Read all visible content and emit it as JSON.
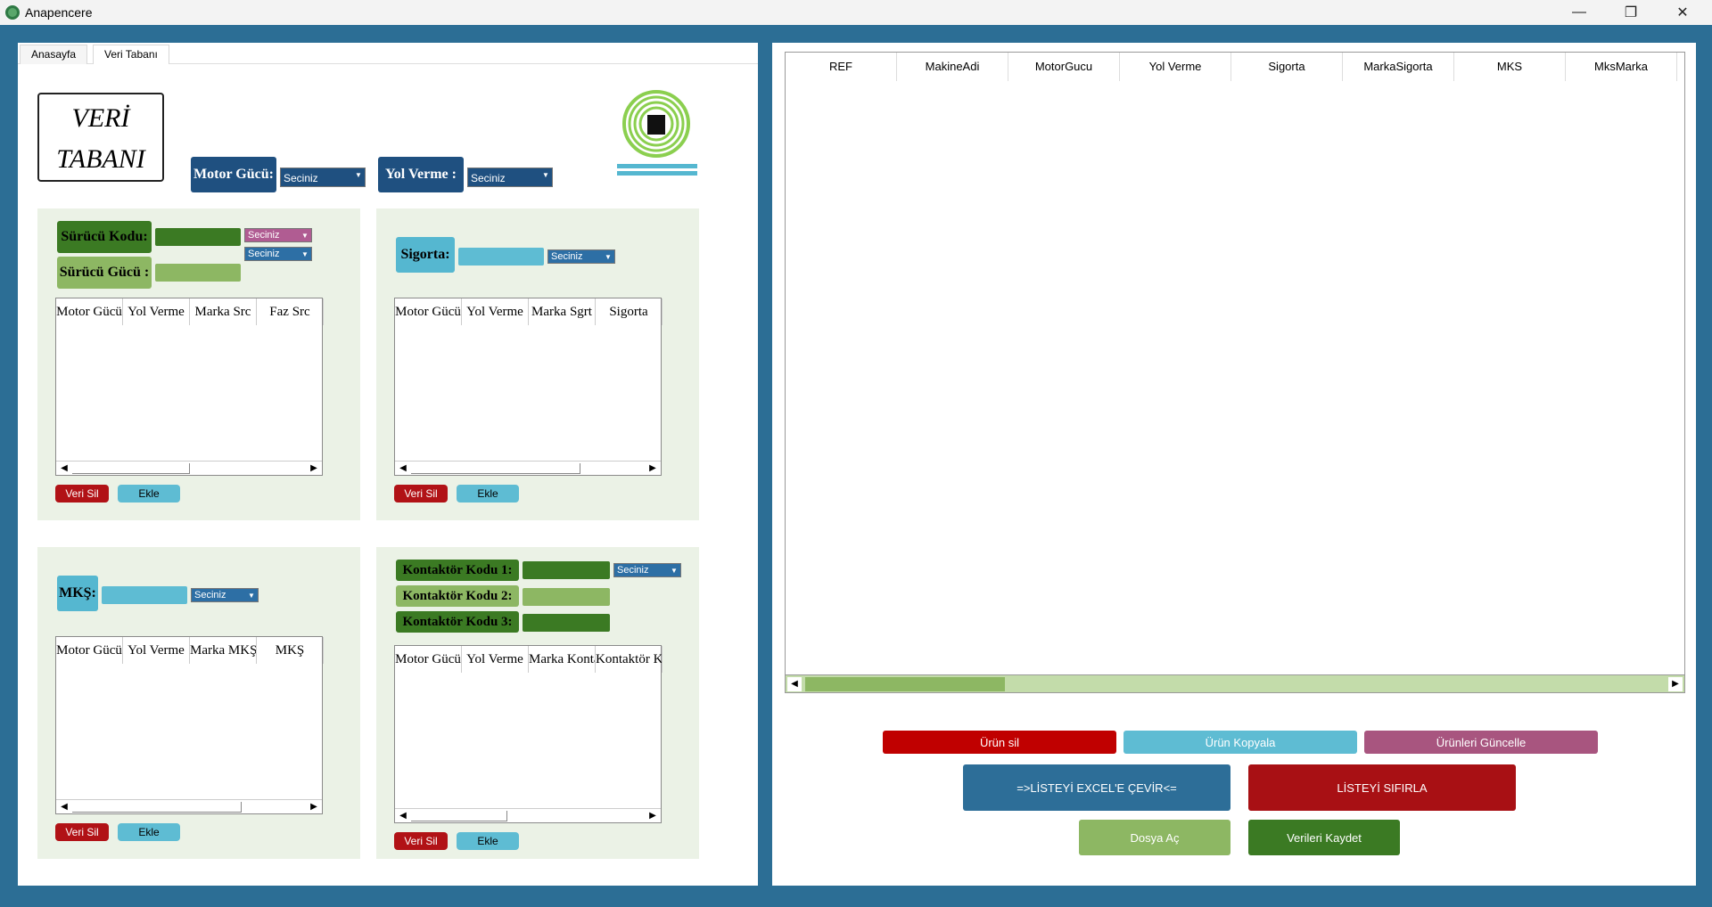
{
  "window": {
    "title": "Anapencere",
    "minimize": "—",
    "restore": "❐",
    "close": "✕"
  },
  "tabs": [
    {
      "label": "Anasayfa"
    },
    {
      "label": "Veri Tabanı"
    }
  ],
  "header": {
    "title_line1": "VERİ",
    "title_line2": "TABANI",
    "motor_gucu_label": "Motor Gücü:",
    "motor_gucu_value": "Seciniz",
    "yol_verme_label": "Yol Verme :",
    "yol_verme_value": "Seciniz"
  },
  "surucu": {
    "kodu_label": "Sürücü Kodu:",
    "gucu_label": "Sürücü Gücü :",
    "combo1": "Seciniz",
    "combo2": "Seciniz",
    "columns": [
      "Motor Gücü",
      "Yol Verme",
      "Marka Src",
      "Faz Src"
    ],
    "delete": "Veri Sil",
    "add": "Ekle"
  },
  "sigorta": {
    "label": "Sigorta:",
    "combo": "Seciniz",
    "columns": [
      "Motor Gücü",
      "Yol Verme",
      "Marka Sgrt",
      "Sigorta"
    ],
    "delete": "Veri Sil",
    "add": "Ekle"
  },
  "mks": {
    "label": "MKŞ:",
    "combo": "Seciniz",
    "columns": [
      "Motor Gücü",
      "Yol Verme",
      "Marka MKŞ",
      "MKŞ"
    ],
    "delete": "Veri Sil",
    "add": "Ekle"
  },
  "kontaktor": {
    "kod1_label": "Kontaktör Kodu 1:",
    "kod2_label": "Kontaktör Kodu 2:",
    "kod3_label": "Kontaktör Kodu 3:",
    "combo": "Seciniz",
    "columns": [
      "Motor Gücü",
      "Yol Verme",
      "Marka Kontak",
      "Kontaktör Kodu"
    ],
    "delete": "Veri Sil",
    "add": "Ekle"
  },
  "main_grid": {
    "columns": [
      "REF",
      "MakineAdi",
      "MotorGucu",
      "Yol Verme",
      "Sigorta",
      "MarkaSigorta",
      "MKS",
      "MksMarka"
    ]
  },
  "actions": {
    "urun_sil": "Ürün sil",
    "urun_kopyala": "Ürün Kopyala",
    "urunleri_guncelle": "Ürünleri Güncelle",
    "excel": "=>LİSTEYİ EXCEL'E ÇEVİR<=",
    "sifirla": "LİSTEYİ SIFIRLA",
    "dosya_ac": "Dosya Aç",
    "kaydet": "Verileri Kaydet"
  },
  "colors": {
    "frame": "#2c6e95",
    "navy": "#1f5080",
    "dark_green": "#3b7a23",
    "light_green": "#8db763",
    "cyan": "#55b7d0",
    "red": "#c00000",
    "pink": "#a8557f"
  }
}
